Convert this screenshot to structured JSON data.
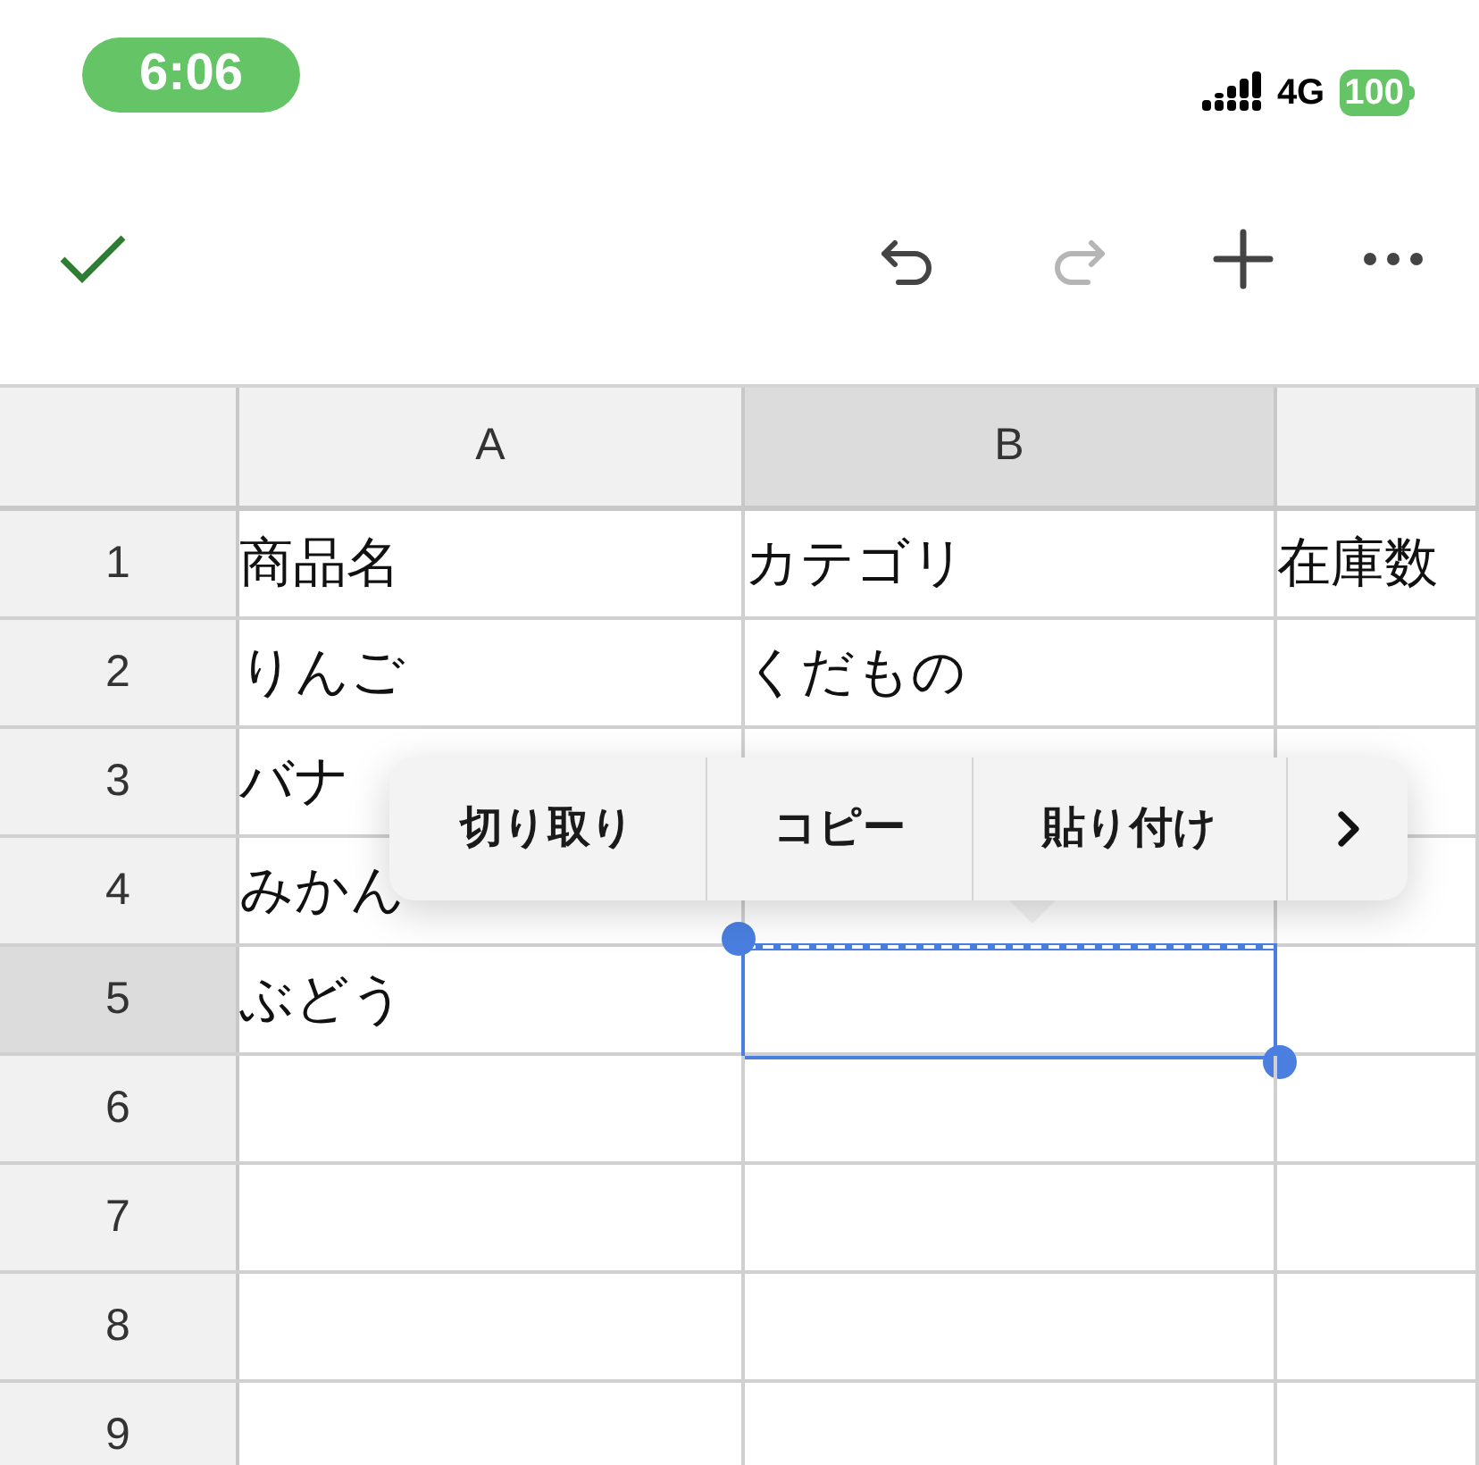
{
  "status_bar": {
    "time": "6:06",
    "network": "4G",
    "battery": "100"
  },
  "toolbar": [
    {
      "kind": "confirm",
      "disabled": false
    },
    {
      "kind": "spacer"
    },
    {
      "kind": "undo",
      "disabled": false
    },
    {
      "kind": "redo",
      "disabled": true
    },
    {
      "kind": "add",
      "disabled": false
    },
    {
      "kind": "more",
      "disabled": false
    }
  ],
  "sheet": {
    "columns": [
      {
        "label": "A",
        "selected": false
      },
      {
        "label": "B",
        "selected": true
      },
      {
        "selected": false
      }
    ],
    "rows": [
      {
        "number": "1",
        "selected": false,
        "cells": [
          "商品名",
          "カテゴリ",
          "在庫数"
        ]
      },
      {
        "number": "2",
        "selected": false,
        "cells": [
          "りんご",
          "くだもの",
          null
        ]
      },
      {
        "number": "3",
        "selected": false,
        "cells": [
          "バナ",
          null,
          null
        ]
      },
      {
        "number": "4",
        "selected": false,
        "cells": [
          "みかん",
          null,
          null
        ]
      },
      {
        "number": "5",
        "selected": true,
        "cells": [
          "ぶどう",
          null,
          null
        ]
      },
      {
        "number": "6",
        "selected": false,
        "cells": [
          null,
          null,
          null
        ]
      },
      {
        "number": "7",
        "selected": false,
        "cells": [
          null,
          null,
          null
        ]
      },
      {
        "number": "8",
        "selected": false,
        "cells": [
          null,
          null,
          null
        ]
      },
      {
        "number": "9",
        "selected": false,
        "cells": [
          null,
          null,
          null
        ]
      }
    ]
  },
  "context_menu": {
    "items": [
      "切り取り",
      "コピー",
      "貼り付け"
    ],
    "has_more": true
  }
}
